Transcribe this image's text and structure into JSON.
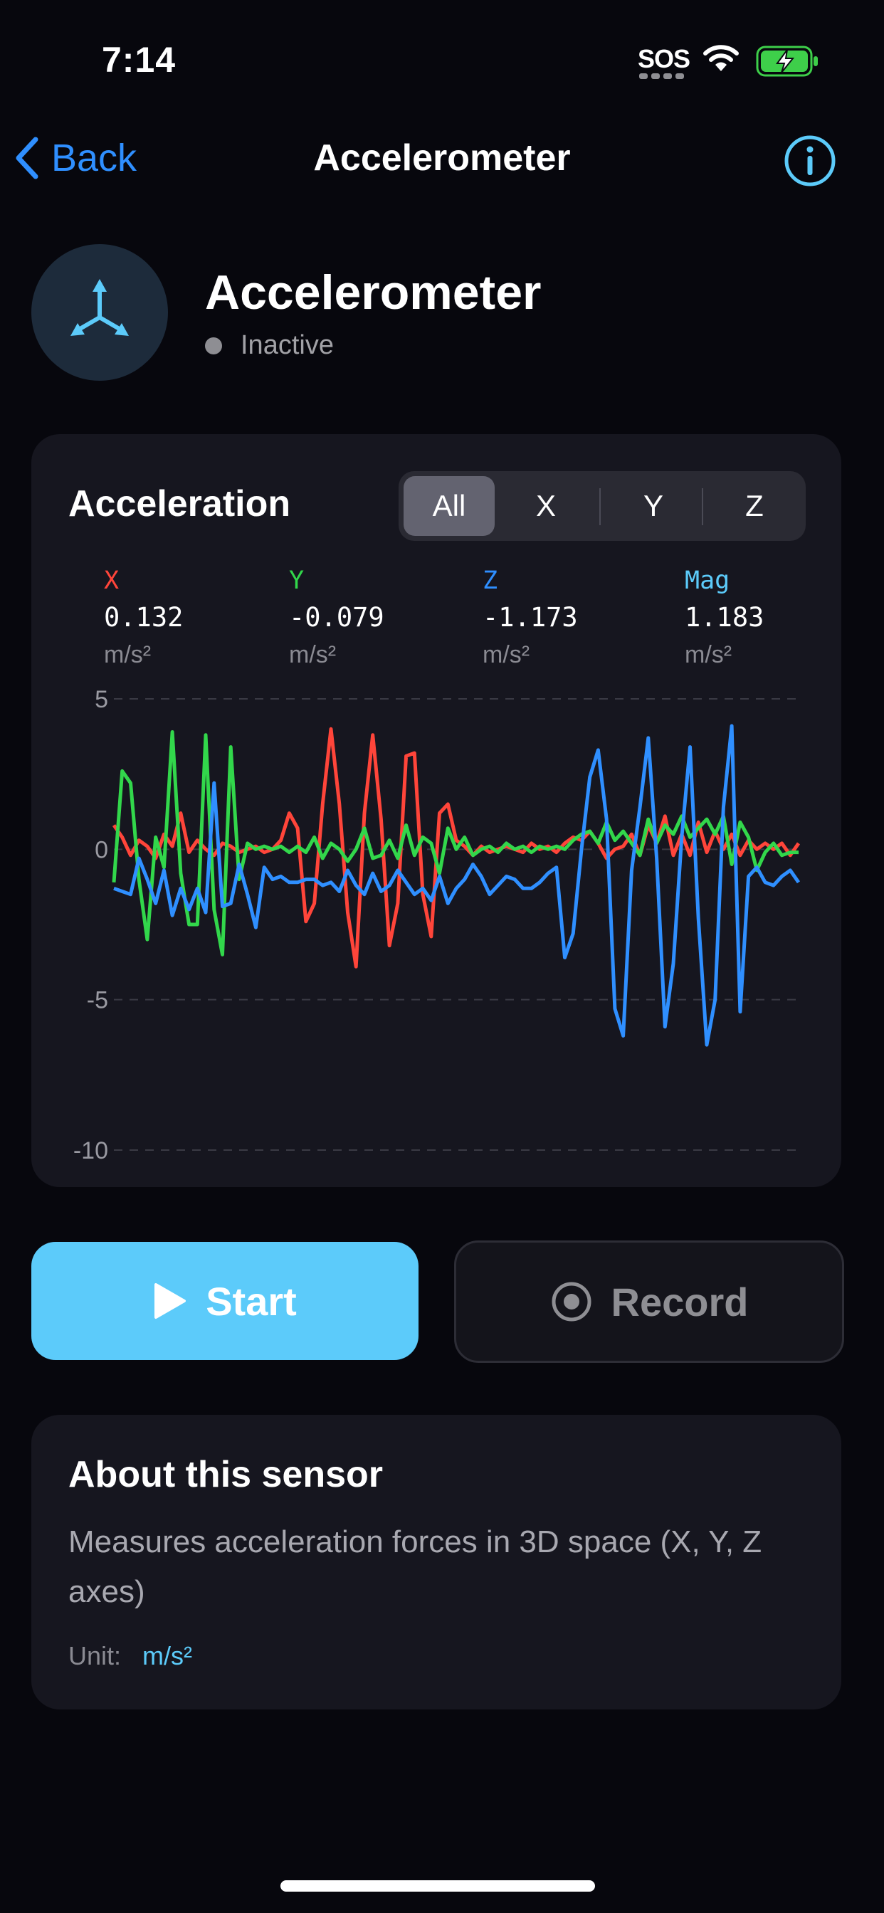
{
  "status_bar": {
    "time": "7:14",
    "sos": "SOS",
    "icons": [
      "wifi-icon",
      "battery-charging-icon"
    ]
  },
  "nav": {
    "back_label": "Back",
    "title": "Accelerometer",
    "info_icon": "info-circle-icon"
  },
  "sensor": {
    "icon": "three-axis-icon",
    "title": "Accelerometer",
    "status": "Inactive"
  },
  "chart_card": {
    "title": "Acceleration",
    "segments": [
      {
        "label": "All",
        "active": true
      },
      {
        "label": "X",
        "active": false
      },
      {
        "label": "Y",
        "active": false
      },
      {
        "label": "Z",
        "active": false
      }
    ],
    "readouts": [
      {
        "label": "X",
        "value": "0.132",
        "unit": "m/s²",
        "color": "#ff453a"
      },
      {
        "label": "Y",
        "value": "-0.079",
        "unit": "m/s²",
        "color": "#32d74b"
      },
      {
        "label": "Z",
        "value": "-1.173",
        "unit": "m/s²",
        "color": "#2f8fff"
      },
      {
        "label": "Mag",
        "value": "1.183",
        "unit": "m/s²",
        "color": "#5ccbfa"
      }
    ]
  },
  "chart_data": {
    "type": "line",
    "title": "Acceleration",
    "xlabel": "",
    "ylabel": "",
    "ylim": [
      -10,
      5
    ],
    "yticks": [
      "5",
      "0",
      "-5",
      "-10"
    ],
    "grid": "dashed horizontal",
    "series": [
      {
        "name": "X",
        "color": "#ff453a",
        "values": [
          0.8,
          0.4,
          -0.2,
          0.3,
          0.1,
          -0.3,
          0.5,
          0.1,
          1.2,
          -0.1,
          0.3,
          0.0,
          -0.2,
          0.2,
          0.1,
          -0.1,
          0.0,
          0.1,
          -0.1,
          0.0,
          0.3,
          1.2,
          0.7,
          -2.4,
          -1.8,
          1.5,
          4.0,
          1.5,
          -2.1,
          -3.9,
          1.2,
          3.8,
          1.0,
          -3.2,
          -1.8,
          3.1,
          3.2,
          -1.5,
          -2.9,
          1.2,
          1.5,
          0.3,
          0.1,
          -0.2,
          0.1,
          -0.1,
          0.0,
          0.1,
          0.0,
          -0.1,
          0.2,
          0.0,
          0.1,
          -0.1,
          0.2,
          0.4,
          0.3,
          0.6,
          0.2,
          -0.3,
          0.0,
          0.1,
          0.5,
          -0.2,
          0.8,
          0.2,
          1.1,
          -0.2,
          0.5,
          -0.2,
          0.9,
          -0.1,
          0.6,
          0.0,
          0.5,
          -0.2,
          0.3,
          0.0,
          0.2,
          0.0,
          0.2,
          -0.2,
          0.2
        ]
      },
      {
        "name": "Y",
        "color": "#32d74b",
        "values": [
          -1.1,
          2.6,
          2.2,
          -1.0,
          -3.0,
          0.4,
          -0.6,
          3.9,
          -0.8,
          -2.5,
          -2.5,
          3.8,
          -2.0,
          -3.5,
          3.4,
          -1.0,
          0.2,
          0.0,
          0.1,
          0.0,
          0.1,
          -0.1,
          0.1,
          -0.1,
          0.4,
          -0.3,
          0.2,
          0.0,
          -0.4,
          0.0,
          0.7,
          -0.3,
          -0.2,
          0.3,
          -0.3,
          0.8,
          -0.2,
          0.4,
          0.2,
          -0.8,
          0.7,
          0.0,
          0.4,
          -0.2,
          0.0,
          0.1,
          -0.1,
          0.2,
          0.0,
          0.1,
          -0.1,
          0.1,
          0.0,
          0.1,
          0.0,
          0.3,
          0.5,
          0.6,
          0.2,
          0.9,
          0.3,
          0.6,
          0.2,
          -0.2,
          1.0,
          0.2,
          0.8,
          0.5,
          1.1,
          0.4,
          0.7,
          1.0,
          0.5,
          1.1,
          -0.5,
          0.9,
          0.4,
          -0.7,
          -0.1,
          0.2,
          -0.2,
          -0.1,
          -0.1
        ]
      },
      {
        "name": "Z",
        "color": "#2f8fff",
        "values": [
          -1.3,
          -1.4,
          -1.5,
          -0.3,
          -1.0,
          -1.8,
          -0.7,
          -2.2,
          -1.3,
          -2.0,
          -1.3,
          -2.1,
          2.2,
          -1.9,
          -1.8,
          -0.5,
          -1.5,
          -2.6,
          -0.6,
          -1.0,
          -0.9,
          -1.1,
          -1.1,
          -1.0,
          -1.0,
          -1.2,
          -1.1,
          -1.4,
          -0.7,
          -1.2,
          -1.5,
          -0.8,
          -1.4,
          -1.2,
          -0.7,
          -1.1,
          -1.5,
          -1.3,
          -1.7,
          -0.9,
          -1.8,
          -1.3,
          -1.0,
          -0.5,
          -0.9,
          -1.5,
          -1.2,
          -0.9,
          -1.0,
          -1.3,
          -1.3,
          -1.1,
          -0.8,
          -0.6,
          -3.6,
          -2.8,
          0.0,
          2.4,
          3.3,
          1.0,
          -5.3,
          -6.2,
          -0.7,
          1.4,
          3.7,
          -0.3,
          -5.9,
          -3.8,
          0.4,
          3.4,
          -2.3,
          -6.5,
          -5.0,
          1.4,
          4.1,
          -5.4,
          -0.9,
          -0.6,
          -1.1,
          -1.2,
          -0.9,
          -0.7,
          -1.1
        ]
      }
    ]
  },
  "buttons": {
    "start_label": "Start",
    "start_icon": "play-icon",
    "record_label": "Record",
    "record_icon": "record-icon"
  },
  "about": {
    "title": "About this sensor",
    "description": "Measures acceleration forces in 3D space (X, Y, Z axes)",
    "unit_label": "Unit:",
    "unit_value": "m/s²"
  }
}
